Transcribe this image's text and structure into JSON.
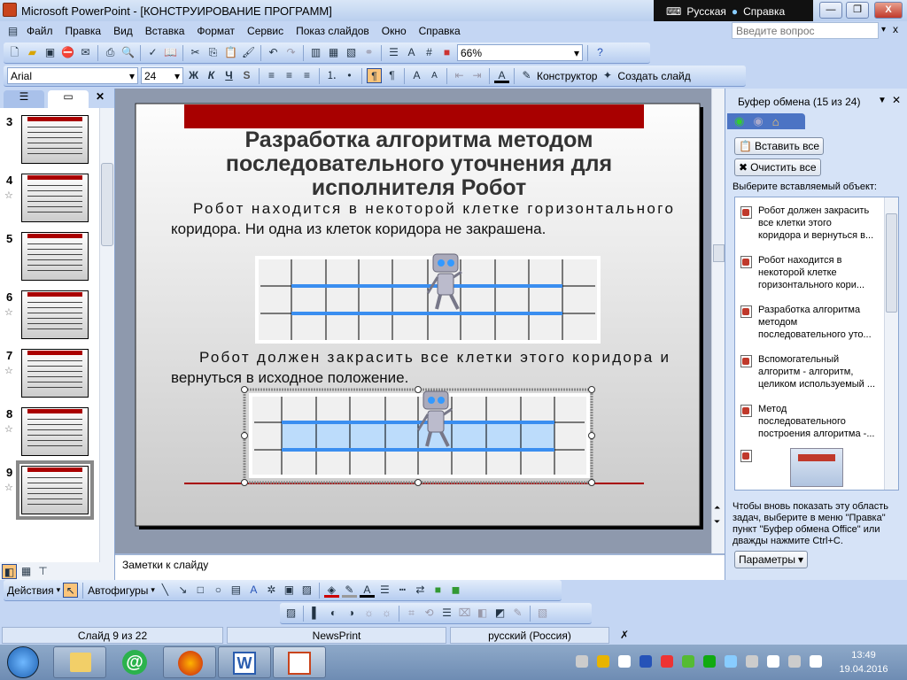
{
  "window": {
    "title": "Microsoft PowerPoint - [КОНСТРУИРОВАНИЕ ПРОГРАММ]",
    "lang": "Русская",
    "help": "Справка"
  },
  "menu": {
    "items": [
      "Файл",
      "Правка",
      "Вид",
      "Вставка",
      "Формат",
      "Сервис",
      "Показ слайдов",
      "Окно",
      "Справка"
    ],
    "ask_placeholder": "Введите вопрос"
  },
  "toolbar": {
    "zoom": "66%"
  },
  "format": {
    "font": "Arial",
    "size": "24",
    "bold": "Ж",
    "italic": "К",
    "underline": "Ч",
    "shadow": "S",
    "designer": "Конструктор",
    "new_slide": "Создать слайд"
  },
  "slides": {
    "thumbs": [
      {
        "num": "3",
        "star": false
      },
      {
        "num": "4",
        "star": true
      },
      {
        "num": "5",
        "star": false
      },
      {
        "num": "6",
        "star": true
      },
      {
        "num": "7",
        "star": true
      },
      {
        "num": "8",
        "star": true
      },
      {
        "num": "9",
        "star": true,
        "selected": true
      }
    ]
  },
  "slide": {
    "title_lines": [
      "Разработка алгоритма методом",
      "последовательного уточнения для",
      "исполнителя Робот"
    ],
    "para1": [
      "Робот находится в некоторой клетке горизонтального",
      "коридора. Ни одна из клеток коридора не закрашена."
    ],
    "para2": [
      "Робот должен закрасить все клетки этого коридора и",
      "вернуться в исходное положение."
    ],
    "colors": {
      "accent": "#a80000",
      "corridor": "#3a8ef0",
      "filled": "#bcdcfb"
    }
  },
  "notes": {
    "placeholder": "Заметки к слайду"
  },
  "taskpane": {
    "title": "Буфер обмена (15 из 24)",
    "paste_all": "Вставить все",
    "clear_all": "Очистить все",
    "choose": "Выберите вставляемый объект:",
    "items": [
      [
        "Робот должен закрасить",
        "все клетки этого",
        "коридора и вернуться в..."
      ],
      [
        "Робот находится в",
        "некоторой клетке",
        "горизонтального кори..."
      ],
      [
        "Разработка алгоритма",
        "методом",
        "последовательного уто..."
      ],
      [
        "Вспомогательный",
        "алгоритм - алгоритм,",
        "целиком используемый ..."
      ],
      [
        "Метод",
        "последовательного",
        "построения алгоритма -..."
      ]
    ],
    "hint": [
      "Чтобы вновь показать эту область",
      "задач, выберите в меню \"Правка\"",
      "пункт \"Буфер обмена Office\" или",
      "дважды нажмите Ctrl+C."
    ],
    "options": "Параметры"
  },
  "drawing": {
    "actions": "Действия",
    "autoshapes": "Автофигуры"
  },
  "status": {
    "slide": "Слайд 9 из 22",
    "design": "NewsPrint",
    "language": "русский (Россия)"
  },
  "clock": {
    "time": "13:49",
    "date": "19.04.2016"
  }
}
